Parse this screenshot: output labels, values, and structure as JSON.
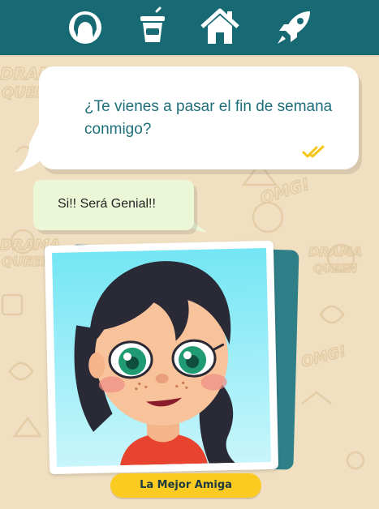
{
  "nav": {
    "items": [
      {
        "name": "avatar",
        "icon": "girl-face-icon"
      },
      {
        "name": "drink",
        "icon": "cup-icon"
      },
      {
        "name": "home",
        "icon": "house-icon"
      },
      {
        "name": "rocket",
        "icon": "rocket-icon"
      }
    ]
  },
  "background": {
    "doodle_texts": [
      "DRAMA",
      "QUEEN",
      "OMG!",
      "DRAMA",
      "QUEEN",
      "OMG!",
      "DRAMA",
      "QUEEN"
    ]
  },
  "chat": {
    "incoming_text": "¿Te vienes a pasar el fin de semana conmigo?",
    "incoming_status_icon": "double-check-icon",
    "outgoing_text": "Si!! Será Genial!!"
  },
  "character": {
    "label": "La Mejor Amiga"
  },
  "colors": {
    "topbar": "#176a73",
    "background": "#f1dfc1",
    "incoming_text": "#1f6f7a",
    "outgoing_bubble": "#ecf7d8",
    "check": "#f5c518",
    "label_pill": "#fccb22"
  }
}
